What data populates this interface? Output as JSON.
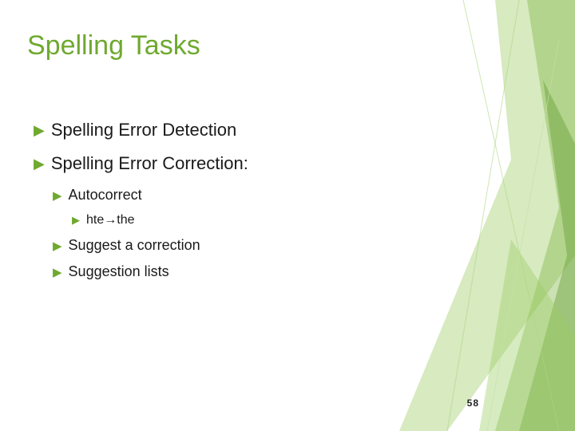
{
  "title": "Spelling Tasks",
  "bullets": {
    "b1": "Spelling Error Detection",
    "b2": "Spelling Error Correction:",
    "b2_1": "Autocorrect",
    "b2_1_1": "hte→the",
    "b2_2": "Suggest a correction",
    "b2_3": "Suggestion lists"
  },
  "page_number": "58"
}
